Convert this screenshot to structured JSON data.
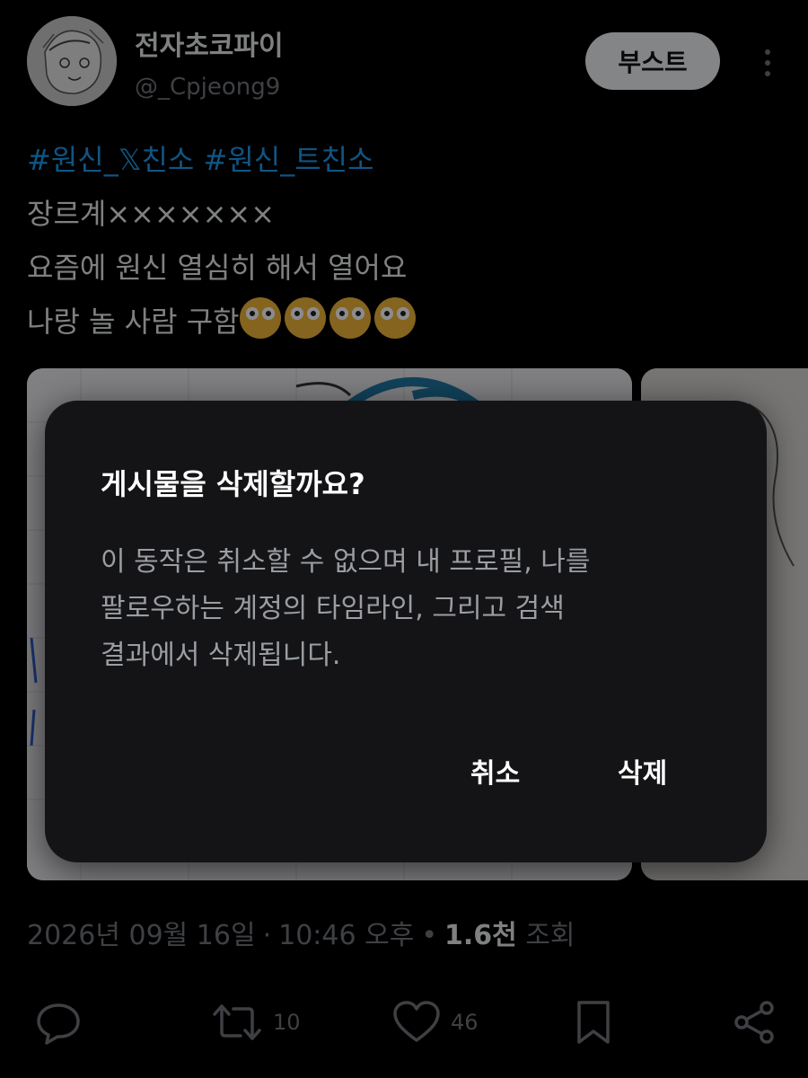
{
  "header": {
    "display_name": "전자초코파이",
    "handle": "@_Cpjeong9",
    "boost_label": "부스트"
  },
  "tweet": {
    "hashtags": [
      "#원신_𝕏친소",
      "#원신_트친소"
    ],
    "lines": [
      "장르계×××××××",
      "요즘에 원신 열심히 해서 열어요",
      "나랑 놀 사람 구함"
    ],
    "emoji_count": 4,
    "emoji_name": "flushed-face"
  },
  "meta": {
    "date": "2026년 09월 16일",
    "time": "10:46 오후",
    "views_count": "1.6천",
    "views_label": "조회"
  },
  "actions": {
    "reply": {
      "icon": "reply-icon"
    },
    "repost": {
      "icon": "repost-icon",
      "count": "10"
    },
    "like": {
      "icon": "heart-icon",
      "count": "46"
    },
    "bookmark": {
      "icon": "bookmark-icon"
    },
    "share": {
      "icon": "share-icon"
    }
  },
  "dialog": {
    "title": "게시물을 삭제할까요?",
    "body_lines": [
      "이 동작은 취소할 수 없으며 내 프로필, 나를",
      "팔로우하는 계정의 타임라인, 그리고 검색",
      "결과에서 삭제됩니다."
    ],
    "cancel_label": "취소",
    "delete_label": "삭제"
  },
  "colors": {
    "background": "#000000",
    "hashtag": "#1d9bf0",
    "muted": "#71767b",
    "dialog_bg": "#141416"
  }
}
